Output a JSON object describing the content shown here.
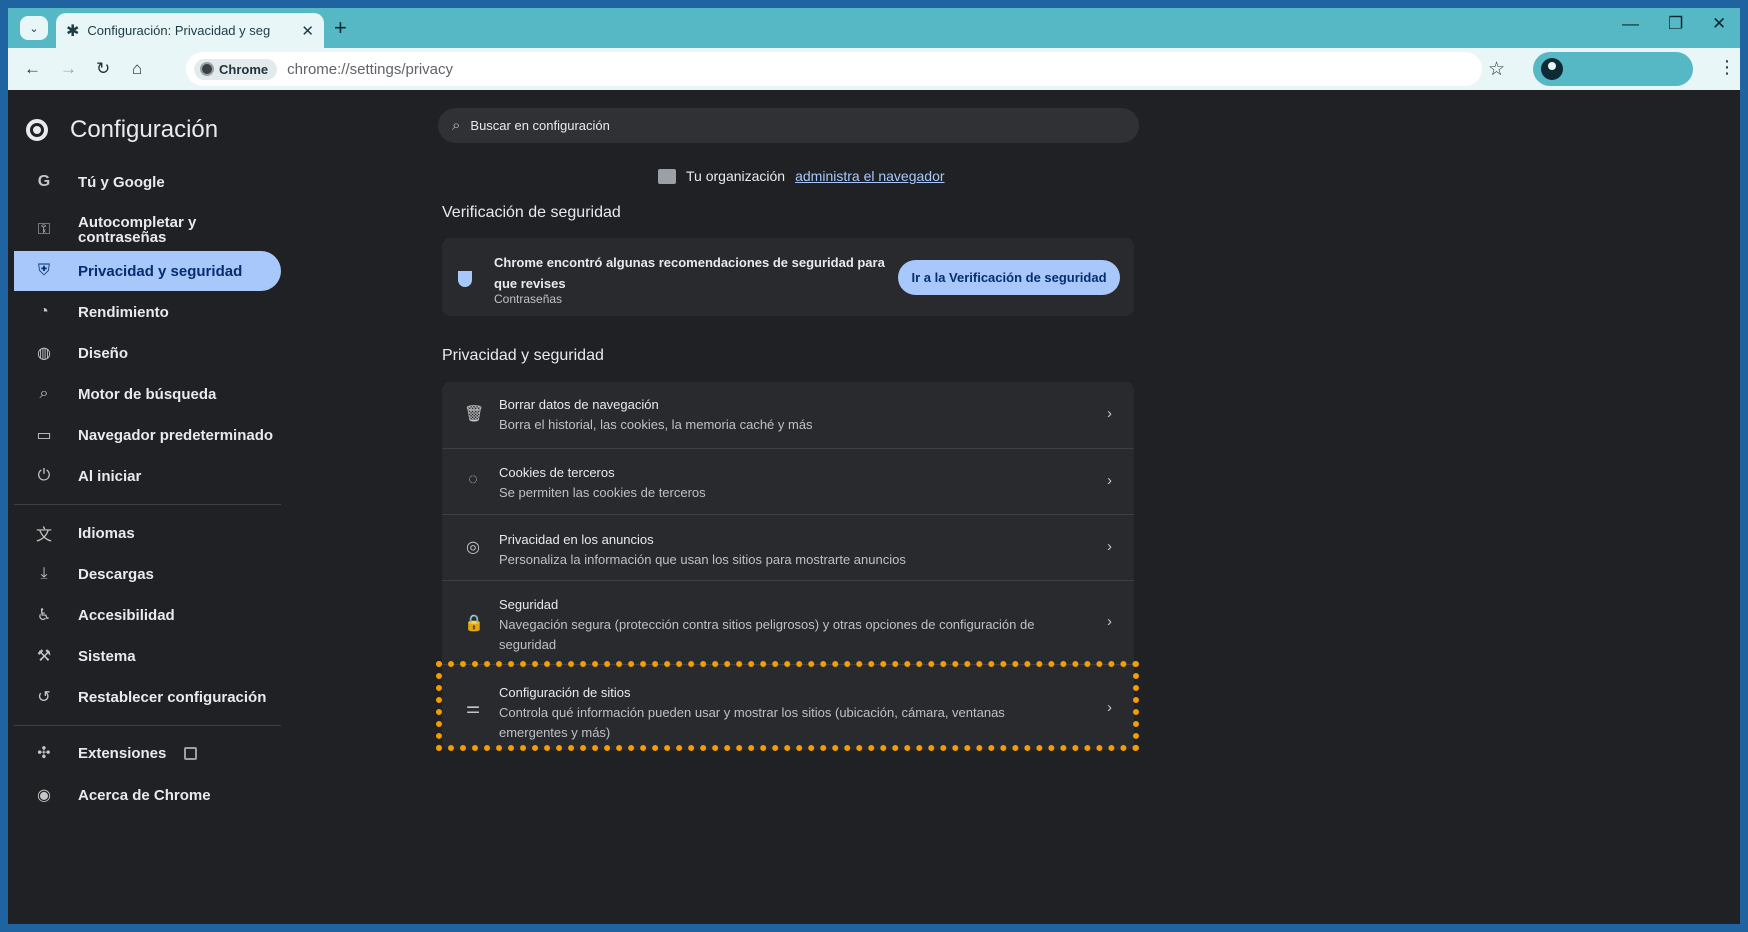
{
  "browser": {
    "tab_title": "Configuración: Privacidad y seg",
    "new_tab_symbol": "+",
    "chip_label": "Chrome",
    "url": "chrome://settings/privacy",
    "window_controls": [
      "—",
      "❐",
      "✕"
    ]
  },
  "sidebar": {
    "title": "Configuración",
    "groups": [
      [
        {
          "label": "Tú y Google",
          "icon": "G"
        },
        {
          "label": "Autocompletar y contraseñas",
          "icon": "key-icon"
        },
        {
          "label": "Privacidad y seguridad",
          "icon": "shield-icon",
          "active": true
        },
        {
          "label": "Rendimiento",
          "icon": "gauge-icon"
        },
        {
          "label": "Diseño",
          "icon": "palette-icon"
        },
        {
          "label": "Motor de búsqueda",
          "icon": "search-icon"
        },
        {
          "label": "Navegador predeterminado",
          "icon": "browser-icon"
        },
        {
          "label": "Al iniciar",
          "icon": "power-icon"
        }
      ],
      [
        {
          "label": "Idiomas",
          "icon": "translate-icon"
        },
        {
          "label": "Descargas",
          "icon": "download-icon"
        },
        {
          "label": "Accesibilidad",
          "icon": "accessibility-icon"
        },
        {
          "label": "Sistema",
          "icon": "wrench-icon"
        },
        {
          "label": "Restablecer configuración",
          "icon": "reset-icon"
        }
      ],
      [
        {
          "label": "Extensiones",
          "icon": "puzzle-icon"
        },
        {
          "label": "Acerca de Chrome",
          "icon": "chrome-icon"
        }
      ]
    ]
  },
  "search": {
    "placeholder": "Buscar en configuración"
  },
  "managed": {
    "text": "Tu organización",
    "link": "administra el navegador"
  },
  "safety_check": {
    "heading": "Verificación de seguridad",
    "title": "Chrome encontró algunas recomendaciones de seguridad para que revises",
    "subtitle": "Contraseñas",
    "button": "Ir a la Verificación de seguridad"
  },
  "privacy": {
    "heading": "Privacidad y seguridad",
    "rows": [
      {
        "title": "Borrar datos de navegación",
        "subtitle": "Borra el historial, las cookies, la memoria caché y más",
        "icon": "trash-icon"
      },
      {
        "title": "Cookies de terceros",
        "subtitle": "Se permiten las cookies de terceros",
        "icon": "cookie-icon"
      },
      {
        "title": "Privacidad en los anuncios",
        "subtitle": "Personaliza la información que usan los sitios para mostrarte anuncios",
        "icon": "ads-icon"
      },
      {
        "title": "Seguridad",
        "subtitle": "Navegación segura (protección contra sitios peligrosos) y otras opciones de configuración de seguridad",
        "icon": "lock-icon"
      },
      {
        "title": "Configuración de sitios",
        "subtitle": "Controla qué información pueden usar y mostrar los sitios (ubicación, cámara, ventanas emergentes y más)",
        "icon": "tune-icon",
        "highlighted": true
      }
    ]
  },
  "colors": {
    "highlight": "#f59c00",
    "accent": "#a8c7fa"
  }
}
